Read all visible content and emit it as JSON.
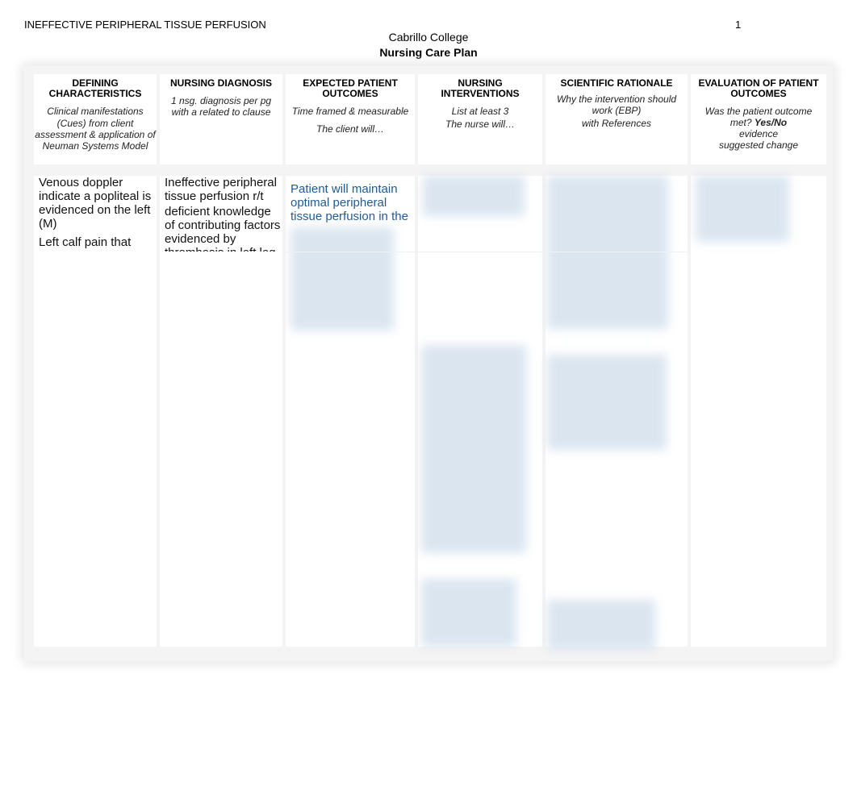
{
  "header": {
    "running_head": "INEFFECTIVE PERIPHERAL TISSUE PERFUSION",
    "page_number": "1",
    "institution": "Cabrillo College",
    "document_title": "Nursing Care Plan"
  },
  "table": {
    "columns": [
      {
        "title": "DEFINING CHARACTERISTICS",
        "subtitle": [
          "Clinical manifestations",
          "(Cues) from client assessment & application of Neuman Systems Model"
        ]
      },
      {
        "title": "NURSING DIAGNOSIS",
        "subtitle": [
          "1 nsg. diagnosis per pg with a related to clause"
        ]
      },
      {
        "title": "EXPECTED PATIENT OUTCOMES",
        "subtitle": [
          "Time framed & measurable",
          "The client will…"
        ]
      },
      {
        "title": "NURSING INTERVENTIONS",
        "subtitle": [
          "List at least 3",
          "The nurse will…"
        ]
      },
      {
        "title": "SCIENTIFIC RATIONALE",
        "subtitle": [
          "Why the intervention should work (EBP)",
          "with References"
        ]
      },
      {
        "title": "EVALUATION OF PATIENT OUTCOMES",
        "subtitle_prefix": "Was the patient outcome met? ",
        "subtitle_bold": "Yes/No",
        "subtitle_rest": [
          "evidence",
          "suggested change"
        ]
      }
    ],
    "body": {
      "defining_characteristics": [
        "Venous doppler indicate a popliteal is evidenced on the left (M)",
        "Left calf pain that"
      ],
      "nursing_diagnosis": [
        "Ineffective peripheral tissue perfusion r/t",
        "deficient knowledge of contributing factors evidenced by thrombosis in left leg"
      ],
      "expected_outcomes": "Patient will maintain optimal peripheral tissue perfusion in the",
      "content_blurred": true
    }
  }
}
